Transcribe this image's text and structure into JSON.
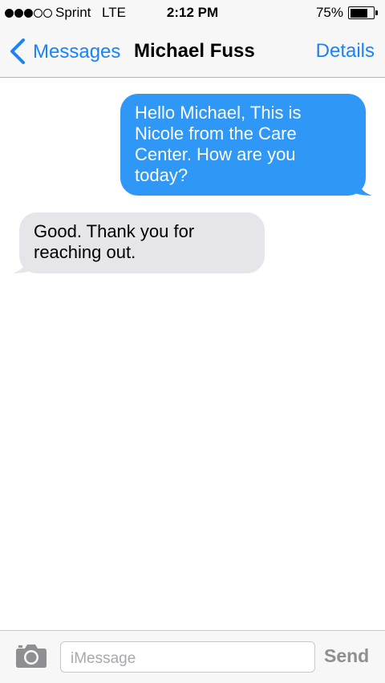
{
  "status_bar": {
    "signal_bars": 5,
    "signal_filled": 3,
    "carrier": "Sprint",
    "network": "LTE",
    "time": "2:12 PM",
    "battery_percent": "75%",
    "battery_level": 0.75
  },
  "nav": {
    "back_label": "Messages",
    "title": "Michael Fuss",
    "details_label": "Details",
    "back_icon": "chevron-left-icon"
  },
  "messages": [
    {
      "direction": "outgoing",
      "text": "Hello Michael, This is Nicole from the Care Center. How are you today?"
    },
    {
      "direction": "incoming",
      "text": "Good. Thank you for reaching out."
    }
  ],
  "input_bar": {
    "camera_icon": "camera-icon",
    "placeholder": "iMessage",
    "value": "",
    "send_label": "Send"
  },
  "colors": {
    "accent": "#1a82fb",
    "outgoing_bubble": "#2f97f5",
    "incoming_bubble": "#e5e5ea",
    "send_disabled": "#8e8e93"
  }
}
